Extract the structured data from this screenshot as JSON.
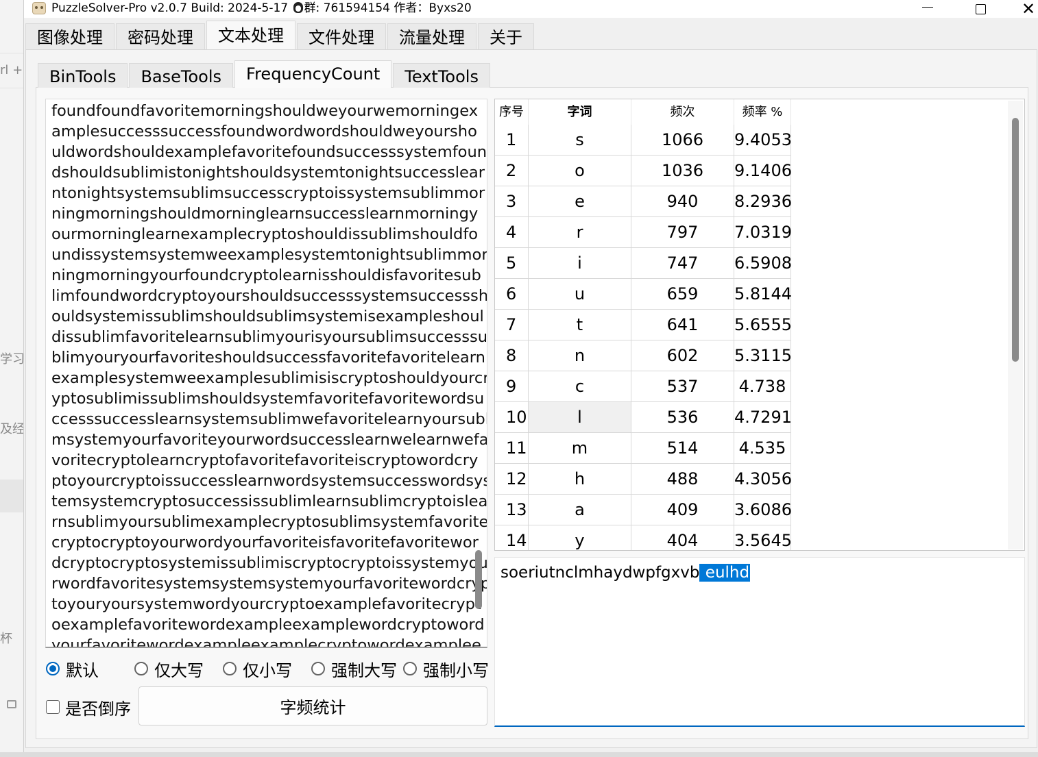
{
  "window": {
    "title": "PuzzleSolver-Pro v2.0.7 Build: 2024-5-17 ",
    "title_suffix": "群: 761594154  作者：Byxs20",
    "minimize_icon": "minimize-icon",
    "maximize_icon": "maximize-icon",
    "close_label": "✕"
  },
  "main_tabs": [
    {
      "label": "图像处理"
    },
    {
      "label": "密码处理"
    },
    {
      "label": "文本处理",
      "active": true
    },
    {
      "label": "文件处理"
    },
    {
      "label": "流量处理"
    },
    {
      "label": "关于"
    }
  ],
  "sub_tabs": [
    {
      "label": "BinTools"
    },
    {
      "label": "BaseTools"
    },
    {
      "label": "FrequencyCount",
      "active": true
    },
    {
      "label": "TextTools"
    }
  ],
  "input": {
    "lines": [
      "foundfoundfavoritemorningshouldweyourwemorningex",
      "amplesuccesssuccessfoundwordwordshouldweyoursho",
      "uldwordshouldexamplefavoritefoundsuccesssystemfoun",
      "dshouldsublimistonightshouldsystemtonightsuccesslear",
      "ntonightsystemsublimsuccesscryptoissystemsublimmor",
      "ningmorningshouldmorninglearnsuccesslearnmorningy",
      "ourmorninglearnexamplecryptoshouldissublimshouldfo",
      "undissystemsystemweexamplesystemtonightsublimmor",
      "ningmorningyourfoundcryptolearnisshouldisfavoritesub",
      "limfoundwordcryptoyourshouldsuccesssystemsuccesssh",
      "ouldsystemissublimshouldsublimsystemisexampleshoul",
      "dissublimfavoritelearnsublimyourisyoursublimsuccesssu",
      "blimyouryourfavoriteshouldsuccessfavoritefavoritelearn",
      "examplesystemweexamplesublimisiscryptoshouldyourcr",
      "yptosublimissublimshouldsystemfavoritefavoritewordsu",
      "ccesssuccesslearnsystemsublimwefavoritelearnyoursubli",
      "msystemyourfavoriteyourwordsuccesslearnwelearnwefa",
      "voritecryptolearncryptofavoritefavoriteiscryptowordcry",
      "ptoyourcryptoissuccesslearnwordsystemsuccesswordsys",
      "temsystemcryptosuccessissublimlearnsublimcryptoislea",
      "rnsublimyoursublimexamplecryptosublimsystemfavorite",
      "cryptocryptoyourwordyourfavoriteisfavoritefavoritewor",
      "dcryptocryptosystemissublimiscryptocryptoissystemyou",
      "rwordfavoritesystemsystemsystemyourfavoritewordcryp",
      "toyouryoursystemwordyourcryptoexamplefavoritecrypt",
      "oexamplefavoritewordexampleexamplewordcryptoword",
      "yourfavoritewordexampleexamplecryptowordexamplee"
    ]
  },
  "options": {
    "radios": [
      {
        "label": "默认",
        "checked": true
      },
      {
        "label": "仅大写"
      },
      {
        "label": "仅小写"
      },
      {
        "label": "强制大写"
      },
      {
        "label": "强制小写"
      }
    ],
    "reverse_label": "是否倒序",
    "count_button": "字频统计"
  },
  "table": {
    "headers": [
      "序号",
      "字词",
      "频次",
      "频率 %"
    ],
    "rows": [
      [
        "1",
        "s",
        "1066",
        "9.4053"
      ],
      [
        "2",
        "o",
        "1036",
        "9.1406"
      ],
      [
        "3",
        "e",
        "940",
        "8.2936"
      ],
      [
        "4",
        "r",
        "797",
        "7.0319"
      ],
      [
        "5",
        "i",
        "747",
        "6.5908"
      ],
      [
        "6",
        "u",
        "659",
        "5.8144"
      ],
      [
        "7",
        "t",
        "641",
        "5.6555"
      ],
      [
        "8",
        "n",
        "602",
        "5.3115"
      ],
      [
        "9",
        "c",
        "537",
        "4.738"
      ],
      [
        "10",
        "l",
        "536",
        "4.7291"
      ],
      [
        "11",
        "m",
        "514",
        "4.535"
      ],
      [
        "12",
        "h",
        "488",
        "4.3056"
      ],
      [
        "13",
        "a",
        "409",
        "3.6086"
      ],
      [
        "14",
        "y",
        "404",
        "3.5645"
      ]
    ],
    "selected_row": 10
  },
  "output": {
    "text": "soeriutnclmhaydwpfgxvb",
    "selected_text": " eulhd"
  },
  "background_app": {
    "fragments": [
      "rl +",
      "学习",
      "及经验",
      "杯"
    ]
  },
  "colors": {
    "accent": "#0067c0",
    "selection": "#0078d7"
  }
}
